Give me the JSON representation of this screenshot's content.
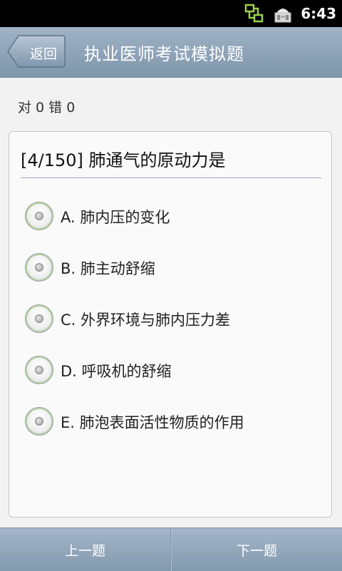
{
  "status_bar": {
    "time": "6:43",
    "icons": [
      "network-sync-icon",
      "android-notification-icon"
    ]
  },
  "header": {
    "back_label": "返回",
    "title": "执业医师考试模拟题"
  },
  "score": {
    "text": "对 0 错 0"
  },
  "question": {
    "text": "[4/150] 肺通气的原动力是",
    "options": [
      {
        "label": "A. 肺内压的变化"
      },
      {
        "label": "B. 肺主动舒缩"
      },
      {
        "label": "C. 外界环境与肺内压力差"
      },
      {
        "label": "D. 呼吸机的舒缩"
      },
      {
        "label": "E. 肺泡表面活性物质的作用"
      }
    ]
  },
  "bottom_nav": {
    "prev_label": "上一题",
    "next_label": "下一题"
  },
  "colors": {
    "header_bg": "#8ea3b8",
    "accent_green": "#9bd04a"
  }
}
